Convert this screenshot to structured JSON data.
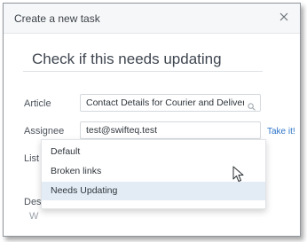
{
  "dialog": {
    "title": "Create a new task",
    "close_icon": "close-icon"
  },
  "task": {
    "title": "Check if this needs updating"
  },
  "fields": {
    "article": {
      "label": "Article",
      "value": "Contact Details for Courier and Delivery Se...",
      "icon": "search-icon"
    },
    "assignee": {
      "label": "Assignee",
      "value": "test@swifteq.test",
      "take_it": "Take it!"
    },
    "list": {
      "label": "List",
      "placeholder": "Needs Updating",
      "icon": "search-icon"
    },
    "description": {
      "label": "Des",
      "value": "W"
    }
  },
  "dropdown": {
    "options": [
      "Default",
      "Broken links",
      "Needs Updating"
    ],
    "highlighted": "Needs Updating"
  },
  "colors": {
    "link": "#2d74c7",
    "highlight": "#e3ecf5",
    "header_bg": "#f6f7f8"
  }
}
